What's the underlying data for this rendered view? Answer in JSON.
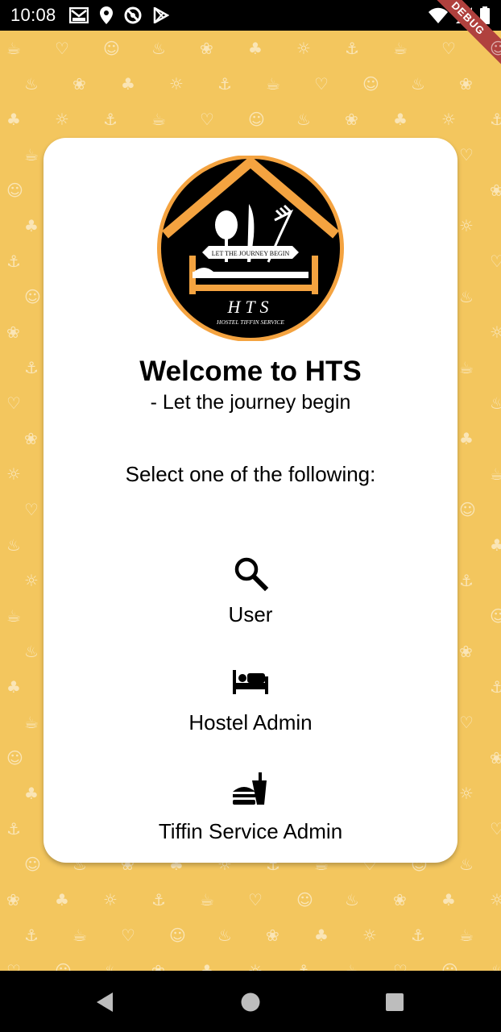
{
  "status_bar": {
    "time": "10:08",
    "left_icons": [
      "gmail-icon",
      "location-icon",
      "do-not-disturb-icon",
      "play-store-icon"
    ],
    "right_icons": [
      "wifi-icon",
      "signal-icon",
      "battery-icon"
    ],
    "debug_banner": "DEBUG"
  },
  "logo": {
    "tagline": "LET THE JOURNEY BEGIN",
    "abbr": "HTS",
    "fullname": "HOSTEL TIFFIN SERVICE"
  },
  "welcome": {
    "title": "Welcome to HTS",
    "subtitle": "- Let the journey begin"
  },
  "prompt": "Select one of the following:",
  "options": [
    {
      "label": "User",
      "icon": "search-icon"
    },
    {
      "label": "Hostel Admin",
      "icon": "bed-icon"
    },
    {
      "label": "Tiffin Service Admin",
      "icon": "fastfood-icon"
    }
  ],
  "nav_bar": {
    "buttons": [
      "back-icon",
      "home-icon",
      "recents-icon"
    ]
  },
  "colors": {
    "background": "#f3c65e",
    "card": "#ffffff",
    "logo_orange": "#f4a340",
    "debug_banner": "#b0413e"
  }
}
